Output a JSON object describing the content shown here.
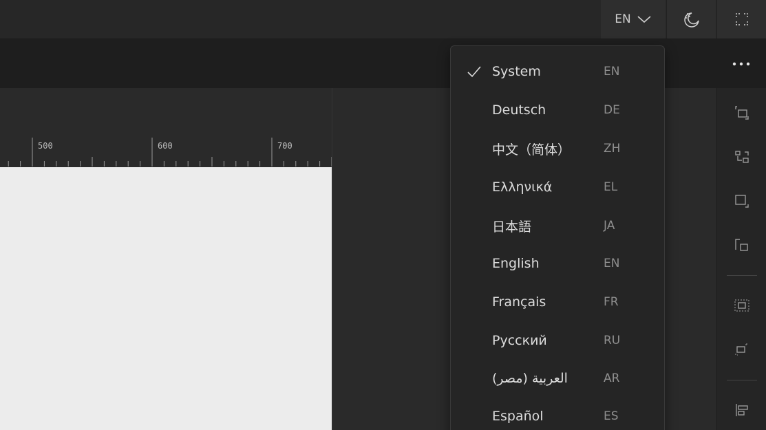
{
  "topbar": {
    "language_button": {
      "code": "EN",
      "icon": "chevron-down-icon"
    },
    "theme_button": {
      "icon": "moon-stars-icon"
    },
    "fullscreen_button": {
      "icon": "fullscreen-icon"
    }
  },
  "secondbar": {
    "more_button": {
      "label": "···",
      "icon": "more-horizontal-icon"
    }
  },
  "ruler": {
    "labels": [
      "500",
      "600",
      "700"
    ]
  },
  "language_menu": {
    "items": [
      {
        "label": "System",
        "code": "EN",
        "selected": true
      },
      {
        "label": "Deutsch",
        "code": "DE",
        "selected": false
      },
      {
        "label": "中文（简体）",
        "code": "ZH",
        "selected": false
      },
      {
        "label": "Ελληνικά",
        "code": "EL",
        "selected": false
      },
      {
        "label": "日本語",
        "code": "JA",
        "selected": false
      },
      {
        "label": "English",
        "code": "EN",
        "selected": false
      },
      {
        "label": "Français",
        "code": "FR",
        "selected": false
      },
      {
        "label": "Русский",
        "code": "RU",
        "selected": false
      },
      {
        "label": "العربية (مصر)",
        "code": "AR",
        "selected": false
      },
      {
        "label": "Español",
        "code": "ES",
        "selected": false
      }
    ]
  },
  "right_toolbar": {
    "tools": [
      "arrange-front-icon",
      "group-icon",
      "frame-icon",
      "ungroup-icon",
      "mask-icon",
      "bool-icon",
      "align-left-icon"
    ]
  },
  "colors": {
    "topbar": "#272727",
    "secondbar": "#1e1e1e",
    "workspace": "#2a2a2a",
    "canvas": "#ececec",
    "menu": "#252525"
  }
}
